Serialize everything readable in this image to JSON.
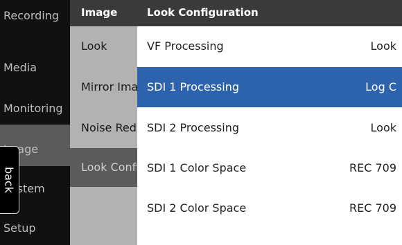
{
  "menu": {
    "items": [
      {
        "label": "Recording"
      },
      {
        "label": "Media"
      },
      {
        "label": "Monitoring"
      },
      {
        "label": "Image"
      },
      {
        "label": "System"
      },
      {
        "label": "Setup"
      }
    ],
    "selected": "Image"
  },
  "submenu": {
    "title": "Image",
    "items": [
      {
        "label": "Look"
      },
      {
        "label": "Mirror Image"
      },
      {
        "label": "Noise Reduction"
      },
      {
        "label": "Look Configuration"
      }
    ],
    "selected": "Look Configuration"
  },
  "detail": {
    "title": "Look Configuration",
    "rows": [
      {
        "label": "VF Processing",
        "value": "Look"
      },
      {
        "label": "SDI 1 Processing",
        "value": "Log C"
      },
      {
        "label": "SDI 2 Processing",
        "value": "Look"
      },
      {
        "label": "SDI 1 Color Space",
        "value": "REC 709"
      },
      {
        "label": "SDI 2 Color Space",
        "value": "REC 709"
      }
    ],
    "selected": "SDI 1 Processing"
  },
  "back_button": {
    "label": "back"
  },
  "colors": {
    "selection_blue": "#2d63ad",
    "header_gray": "#3a3a3a"
  }
}
